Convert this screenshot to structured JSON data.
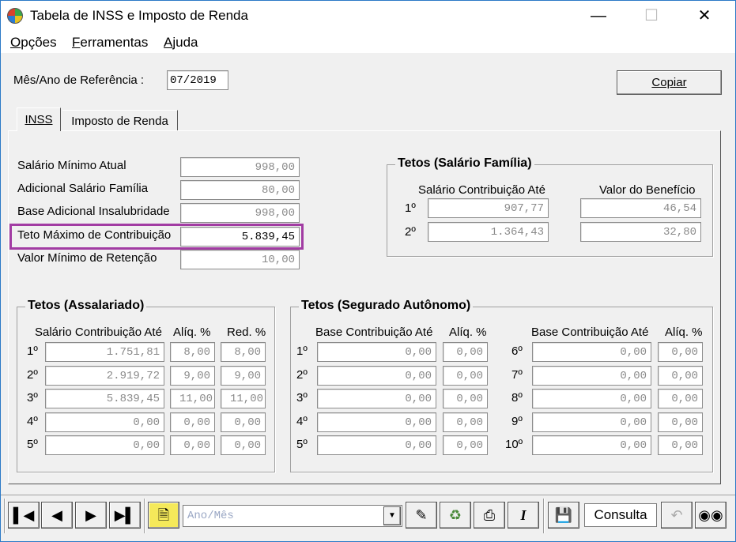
{
  "window": {
    "title": "Tabela de INSS e Imposto de Renda"
  },
  "menu": [
    "Opções",
    "Ferramentas",
    "Ajuda"
  ],
  "reference": {
    "label": "Mês/Ano de Referência :",
    "value": "07/2019"
  },
  "copy_button": "Copiar",
  "tabs": [
    "INSS",
    "Imposto de Renda"
  ],
  "inss": {
    "fields": [
      {
        "label": "Salário Mínimo Atual",
        "value": "998,00"
      },
      {
        "label": "Adicional Salário Família",
        "value": "80,00"
      },
      {
        "label": "Base Adicional Insalubridade",
        "value": "998,00"
      },
      {
        "label": "Teto Máximo de Contribuição",
        "value": "5.839,45"
      },
      {
        "label": "Valor Mínimo de Retenção",
        "value": "10,00"
      }
    ],
    "salario_familia": {
      "title": "Tetos (Salário Família)",
      "col1": "Salário Contribuição Até",
      "col2": "Valor do Benefício",
      "rows": [
        {
          "n": "1º",
          "ate": "907,77",
          "valor": "46,54"
        },
        {
          "n": "2º",
          "ate": "1.364,43",
          "valor": "32,80"
        }
      ]
    },
    "assalariado": {
      "title": "Tetos (Assalariado)",
      "col1": "Salário Contribuição Até",
      "col2": "Alíq. %",
      "col3": "Red. %",
      "rows": [
        {
          "n": "1º",
          "ate": "1.751,81",
          "aliq": "8,00",
          "red": "8,00"
        },
        {
          "n": "2º",
          "ate": "2.919,72",
          "aliq": "9,00",
          "red": "9,00"
        },
        {
          "n": "3º",
          "ate": "5.839,45",
          "aliq": "11,00",
          "red": "11,00"
        },
        {
          "n": "4º",
          "ate": "0,00",
          "aliq": "0,00",
          "red": "0,00"
        },
        {
          "n": "5º",
          "ate": "0,00",
          "aliq": "0,00",
          "red": "0,00"
        }
      ]
    },
    "autonomo": {
      "title": "Tetos (Segurado Autônomo)",
      "col1": "Base Contribuição Até",
      "col2": "Alíq. %",
      "rows_left": [
        {
          "n": "1º",
          "base": "0,00",
          "aliq": "0,00"
        },
        {
          "n": "2º",
          "base": "0,00",
          "aliq": "0,00"
        },
        {
          "n": "3º",
          "base": "0,00",
          "aliq": "0,00"
        },
        {
          "n": "4º",
          "base": "0,00",
          "aliq": "0,00"
        },
        {
          "n": "5º",
          "base": "0,00",
          "aliq": "0,00"
        }
      ],
      "rows_right": [
        {
          "n": "6º",
          "base": "0,00",
          "aliq": "0,00"
        },
        {
          "n": "7º",
          "base": "0,00",
          "aliq": "0,00"
        },
        {
          "n": "8º",
          "base": "0,00",
          "aliq": "0,00"
        },
        {
          "n": "9º",
          "base": "0,00",
          "aliq": "0,00"
        },
        {
          "n": "10º",
          "base": "0,00",
          "aliq": "0,00"
        }
      ]
    }
  },
  "toolbar": {
    "combo_placeholder": "Ano/Mês",
    "status": "Consulta",
    "buttons": [
      "first-record-icon",
      "previous-record-icon",
      "next-record-icon",
      "last-record-icon",
      "new-document-icon",
      "edit-icon",
      "recycle-bin-icon",
      "printer-icon",
      "italic-icon",
      "save-disk-icon",
      "undo-icon",
      "binoculars-icon"
    ]
  },
  "colors": {
    "highlight": "#a23ca3",
    "window_bg": "#f0f0f0",
    "field_text": "#8a8a8a",
    "combo_text": "#9aa7c4"
  }
}
